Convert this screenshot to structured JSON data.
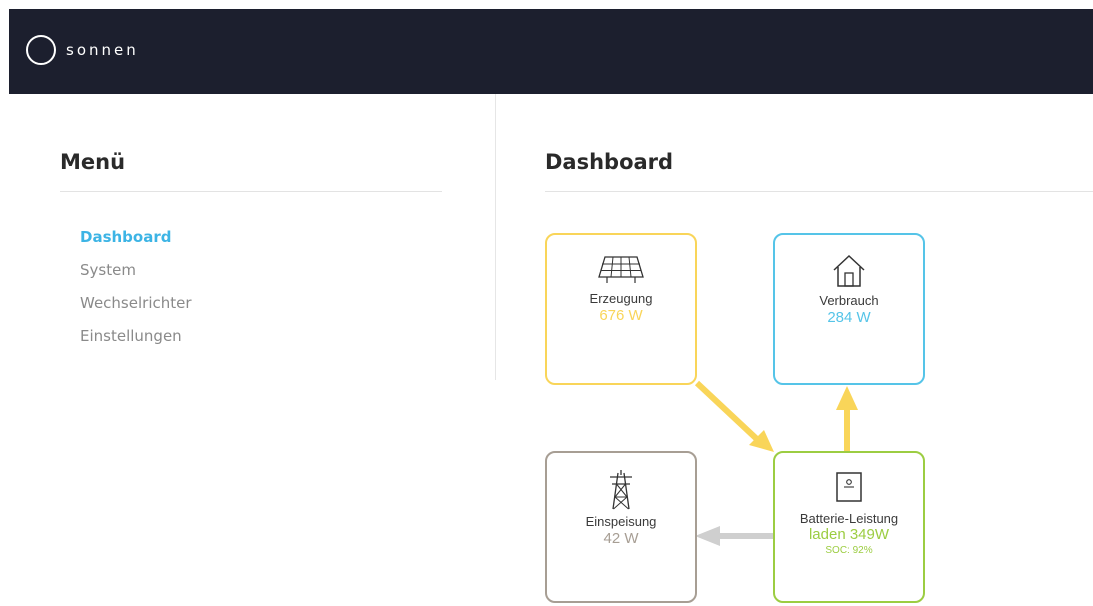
{
  "header": {
    "brand": "sonnen"
  },
  "sidebar": {
    "title": "Menü",
    "items": [
      {
        "label": "Dashboard",
        "active": true
      },
      {
        "label": "System",
        "active": false
      },
      {
        "label": "Wechselrichter",
        "active": false
      },
      {
        "label": "Einstellungen",
        "active": false
      }
    ]
  },
  "main": {
    "title": "Dashboard",
    "tiles": {
      "erzeugung": {
        "label": "Erzeugung",
        "value": "676 W",
        "icon": "solar-panel-icon",
        "color": "#f9d559"
      },
      "verbrauch": {
        "label": "Verbrauch",
        "value": "284 W",
        "icon": "house-icon",
        "color": "#55c4e8"
      },
      "einspeisung": {
        "label": "Einspeisung",
        "value": "42 W",
        "icon": "power-pylon-icon",
        "color": "#a79e94"
      },
      "batterie": {
        "label": "Batterie-Leistung",
        "value": "laden 349W",
        "soc": "SOC: 92%",
        "icon": "battery-icon",
        "color": "#9ccd42"
      }
    },
    "flows": {
      "erzeugung_to_batterie": "#f9d559",
      "batterie_to_verbrauch": "#f9d559",
      "batterie_to_einspeisung": "#cfcfcf"
    }
  },
  "colors": {
    "header_bg": "#1c1f2e",
    "accent": "#3cb4e5"
  }
}
